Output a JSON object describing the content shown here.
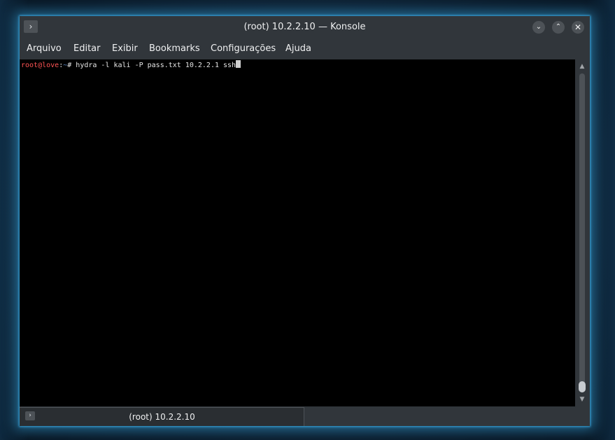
{
  "window": {
    "title": "(root) 10.2.2.10 — Konsole",
    "app_icon": "terminal-prompt-icon",
    "buttons": {
      "minimize_icon": "chevron-down-icon",
      "maximize_icon": "chevron-up-icon",
      "close_icon": "close-icon"
    }
  },
  "menu": {
    "items": [
      {
        "label": "Arquivo"
      },
      {
        "label": "Editar"
      },
      {
        "label": "Exibir"
      },
      {
        "label": "Bookmarks"
      },
      {
        "label": "Configurações"
      },
      {
        "label": "Ajuda"
      }
    ]
  },
  "terminal": {
    "prompt_user": "root@love",
    "prompt_sep": ":",
    "prompt_path": "~",
    "prompt_symbol": "# ",
    "command": "hydra -l kali -P pass.txt 10.2.2.1 ssh"
  },
  "tabs": [
    {
      "label": "(root) 10.2.2.10",
      "icon": "terminal-prompt-icon",
      "active": true
    }
  ],
  "colors": {
    "chrome": "#31363b",
    "terminal_bg": "#000000",
    "prompt_user": "#ff5454",
    "prompt_path": "#5a88c8",
    "window_glow": "#3daee9"
  }
}
